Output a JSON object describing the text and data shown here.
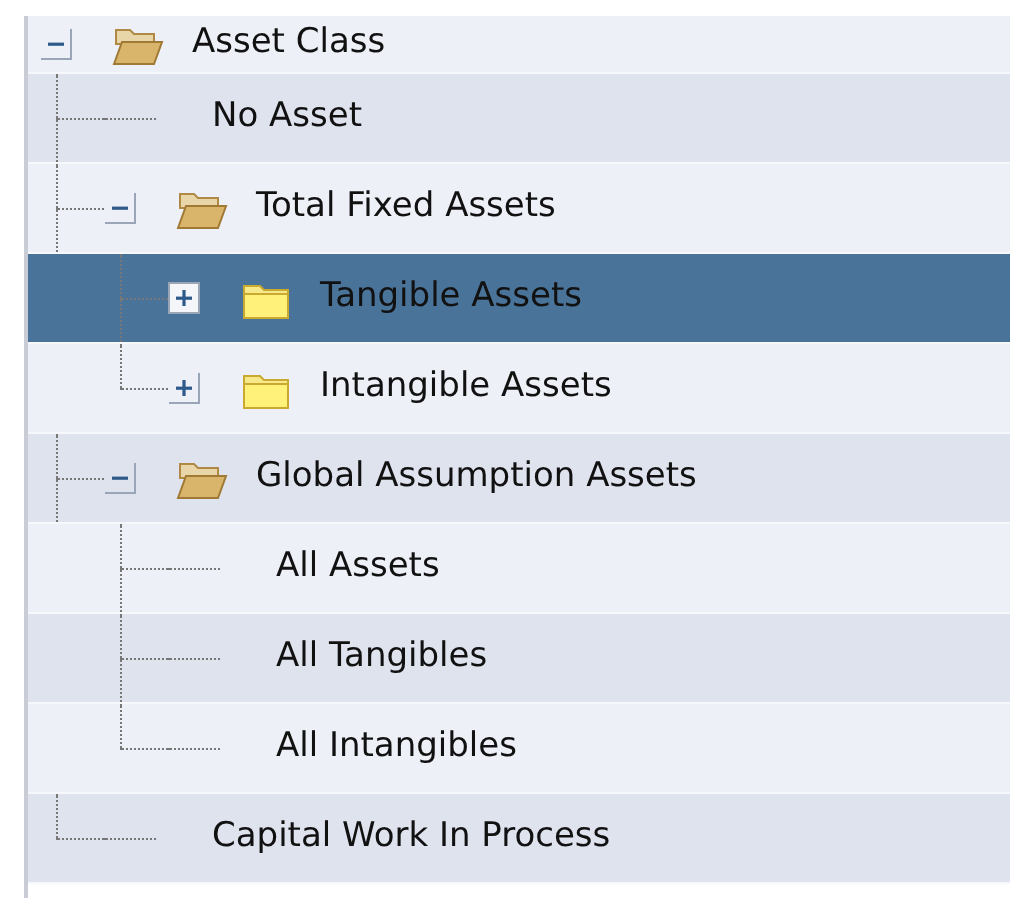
{
  "tree": [
    {
      "label": "Asset Class",
      "kind": "folder",
      "expanded": true,
      "selected": false,
      "children": [
        {
          "label": "No Asset",
          "kind": "leaf",
          "selected": false
        },
        {
          "label": "Total Fixed Assets",
          "kind": "folder",
          "expanded": true,
          "selected": false,
          "children": [
            {
              "label": "Tangible Assets",
              "kind": "folder",
              "expanded": false,
              "selected": true
            },
            {
              "label": "Intangible Assets",
              "kind": "folder",
              "expanded": false,
              "selected": false
            }
          ]
        },
        {
          "label": "Global Assumption Assets",
          "kind": "folder",
          "expanded": true,
          "selected": false,
          "children": [
            {
              "label": "All Assets",
              "kind": "leaf",
              "selected": false
            },
            {
              "label": "All Tangibles",
              "kind": "leaf",
              "selected": false
            },
            {
              "label": "All Intangibles",
              "kind": "leaf",
              "selected": false
            }
          ]
        },
        {
          "label": "Capital Work In Process",
          "kind": "leaf",
          "selected": false
        }
      ]
    }
  ]
}
